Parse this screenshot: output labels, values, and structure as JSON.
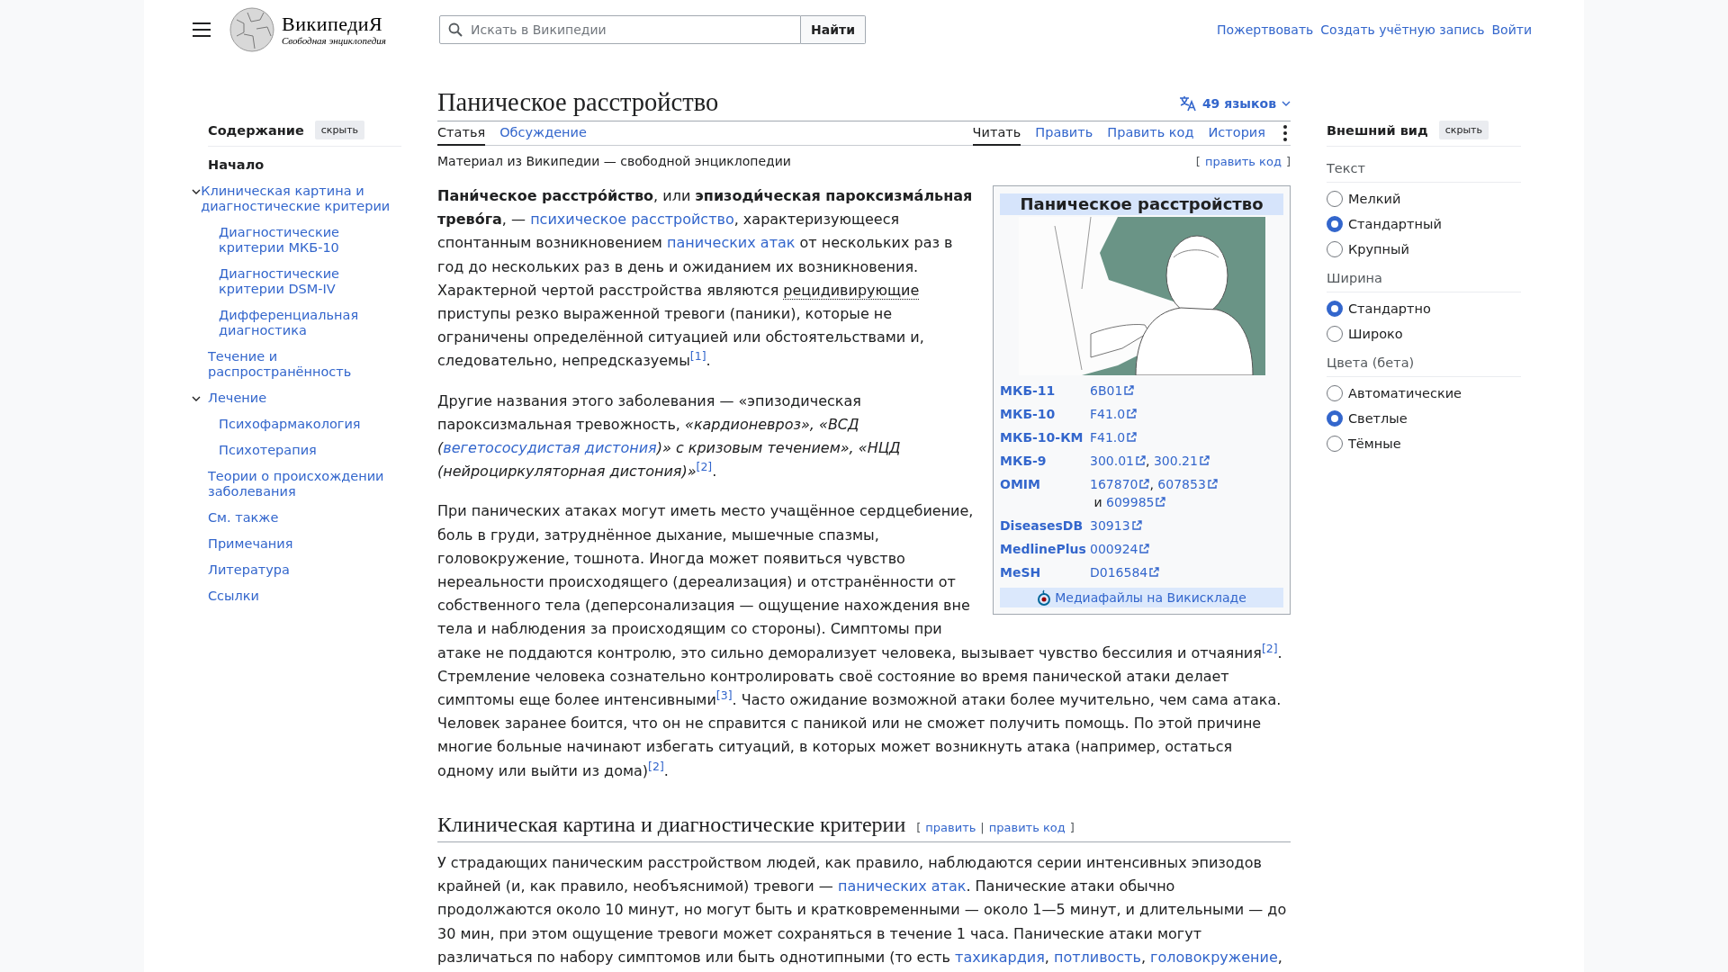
{
  "header": {
    "wordmark": "ВикипедиЯ",
    "tagline": "Свободная энциклопедия",
    "search": {
      "placeholder": "Искать в Википедии",
      "button": "Найти"
    },
    "links": [
      "Пожертвовать",
      "Создать учётную запись",
      "Войти"
    ]
  },
  "toc": {
    "title": "Содержание",
    "hide_button": "скрыть",
    "items": [
      {
        "label": "Начало",
        "selected": true,
        "expanded": false
      },
      {
        "label": "Клиническая картина и диагностические критерии",
        "selected": false,
        "expanded": true,
        "children": [
          {
            "label": "Диагностические критерии МКБ-10",
            "selected": false
          },
          {
            "label": "Диагностические критерии DSM-IV",
            "selected": false
          },
          {
            "label": "Дифференциальная диагностика",
            "selected": false
          }
        ]
      },
      {
        "label": "Течение и распространённость",
        "selected": false,
        "expanded": false
      },
      {
        "label": "Лечение",
        "selected": false,
        "expanded": true,
        "children": [
          {
            "label": "Психофармакология",
            "selected": false
          },
          {
            "label": "Психотерапия",
            "selected": false
          }
        ]
      },
      {
        "label": "Теории о происхождении заболевания",
        "selected": false,
        "expanded": false
      },
      {
        "label": "См. также",
        "selected": false,
        "expanded": false
      },
      {
        "label": "Примечания",
        "selected": false,
        "expanded": false
      },
      {
        "label": "Литература",
        "selected": false,
        "expanded": false
      },
      {
        "label": "Ссылки",
        "selected": false,
        "expanded": false
      }
    ]
  },
  "article": {
    "title": "Паническое расстройство",
    "languages": "49 языков",
    "namespace_tabs": [
      {
        "label": "Статья",
        "selected": true
      },
      {
        "label": "Обсуждение",
        "selected": false
      }
    ],
    "view_tabs": [
      {
        "label": "Читать",
        "selected": true
      },
      {
        "label": "Править",
        "selected": false
      },
      {
        "label": "Править код",
        "selected": false
      },
      {
        "label": "История",
        "selected": false
      }
    ],
    "site_sub": "Материал из Википедии — свободной энциклопедии",
    "top_edit": {
      "open": "[",
      "link": "править код",
      "close": "]"
    },
    "beside_infobox": [
      [
        {
          "kind": "text",
          "text": "**Пани́ческое расстро́йство**, или **эпизоди́ческая пароксизма́льная трево́га**, — "
        },
        {
          "kind": "link",
          "text": "психическое расстройство"
        },
        {
          "kind": "text",
          "text": ", характеризующееся спонтанным возникновением "
        },
        {
          "kind": "link",
          "text": "панических атак"
        },
        {
          "kind": "text",
          "text": " от нескольких раз в год до нескольких раз в день и ожиданием их возникновения. Характерной чертой расстройства являются "
        },
        {
          "kind": "abbr",
          "text": "рецидивирующие"
        },
        {
          "kind": "text",
          "text": " приступы резко выраженной тревоги (паники), которые не ограничены определённой ситуацией или обстоятельствами и, следовательно, непредсказуемы"
        },
        {
          "kind": "ref",
          "text": "[1]"
        },
        {
          "kind": "text",
          "text": "."
        }
      ],
      [
        {
          "kind": "text",
          "text": "Другие названия этого заболевания — «эпизодическая пароксизмальная тревожность, *«кардионевроз», «ВСД (*"
        },
        {
          "kind": "link",
          "text": "вегетососудистая дистония",
          "italic": true
        },
        {
          "kind": "text",
          "text": "*)» с кризовым течением», «НЦД (нейроциркуляторная дистония)»*"
        },
        {
          "kind": "ref",
          "text": "[2]"
        },
        {
          "kind": "text",
          "text": "."
        }
      ],
      [
        {
          "kind": "text",
          "text": "При панических атаках могут иметь место учащённое сердцебиение, боль в груди, затруднённое дыхание, мышечные спазмы, головокружение, тошнота. Иногда может появиться чувство нереальности происходящего (дереализация) и отстранённости от собственного тела (деперсонализация — ощущение нахождения вне тела и наблюдения за происходящим со стороны). Симптомы при"
        }
      ]
    ],
    "below_infobox": [
      [
        {
          "kind": "text",
          "text": "атаке не поддаются контролю, это сильно деморализует человека, вызывает чувство бессилия и отчаяния"
        },
        {
          "kind": "ref",
          "text": "[2]"
        },
        {
          "kind": "text",
          "text": ". Стремление человека сознательно контролировать своё состояние во время панической атаки делает симптомы еще более интенсивными"
        },
        {
          "kind": "ref",
          "text": "[3]"
        },
        {
          "kind": "text",
          "text": ". Часто ожидание возможной атаки более мучительно, чем сама атака. Человек заранее боится, что он не справится с паникой или не сможет получить помощь. По этой причине многие больные начинают избегать ситуаций, в которых может возникнуть атака (например, остаться одному или выйти из дома)"
        },
        {
          "kind": "ref",
          "text": "[2]"
        },
        {
          "kind": "text",
          "text": "."
        }
      ]
    ],
    "sections": [
      {
        "heading": "Клиническая картина и диагностические критерии",
        "edit": {
          "open": "[",
          "links": [
            "править",
            "править код"
          ],
          "separator": "|",
          "close": "]"
        },
        "paragraphs": [
          [
            {
              "kind": "text",
              "text": "У страдающих паническим расстройством людей, как правило, наблюдаются серии интенсивных эпизодов крайней (и, как правило, необъяснимой) тревоги — "
            },
            {
              "kind": "link",
              "text": "панических атак"
            },
            {
              "kind": "text",
              "text": ". Панические атаки обычно продолжаются около 10 минут, но могут быть и кратковременными — около 1—5 минут, и длительными — до 30 мин, при этом ощущение тревоги может сохраняться в течение 1 часа. Панические атаки могут различаться по набору симптомов или быть однотипными (то есть "
            },
            {
              "kind": "link",
              "text": "тахикардия"
            },
            {
              "kind": "text",
              "text": ", "
            },
            {
              "kind": "link",
              "text": "потливость"
            },
            {
              "kind": "text",
              "text": ", "
            },
            {
              "kind": "link",
              "text": "головокружение"
            },
            {
              "kind": "text",
              "text": ","
            }
          ]
        ]
      }
    ]
  },
  "infobox": {
    "title": "Паническое расстройство",
    "rows": [
      {
        "label": "МКБ-11",
        "values": [
          {
            "kind": "external_link",
            "text": "6B01"
          }
        ]
      },
      {
        "label": "МКБ-10",
        "values": [
          {
            "kind": "external_link",
            "text": "F41.0"
          }
        ]
      },
      {
        "label": "МКБ-10-КМ",
        "values": [
          {
            "kind": "external_link",
            "text": "F41.0"
          }
        ]
      },
      {
        "label": "МКБ-9",
        "values": [
          {
            "kind": "external_link",
            "text": "300.01"
          },
          {
            "kind": "text",
            "text": ", "
          },
          {
            "kind": "external_link",
            "text": "300.21"
          }
        ]
      },
      {
        "label": "OMIM",
        "values": [
          {
            "kind": "external_link",
            "text": "167870"
          },
          {
            "kind": "text",
            "text": ", "
          },
          {
            "kind": "external_link",
            "text": "607853"
          },
          {
            "kind": "text",
            "text": " и "
          },
          {
            "kind": "external_link",
            "text": "609985"
          }
        ]
      },
      {
        "label": "DiseasesDB",
        "values": [
          {
            "kind": "external_link",
            "text": "30913"
          }
        ]
      },
      {
        "label": "MedlinePlus",
        "values": [
          {
            "kind": "external_link",
            "text": "000924"
          }
        ]
      },
      {
        "label": "MeSH",
        "values": [
          {
            "kind": "external_link",
            "text": "D016584"
          }
        ]
      }
    ],
    "commons_link": "Медиафайлы на Викискладе"
  },
  "appearance": {
    "title": "Внешний вид",
    "hide_button": "скрыть",
    "groups": [
      {
        "title": "Текст",
        "options": [
          {
            "label": "Мелкий",
            "selected": false
          },
          {
            "label": "Стандартный",
            "selected": true
          },
          {
            "label": "Крупный",
            "selected": false
          }
        ]
      },
      {
        "title": "Ширина",
        "options": [
          {
            "label": "Стандартно",
            "selected": true
          },
          {
            "label": "Широко",
            "selected": false
          }
        ]
      },
      {
        "title": "Цвета (бета)",
        "options": [
          {
            "label": "Автоматические",
            "selected": false
          },
          {
            "label": "Светлые",
            "selected": true
          },
          {
            "label": "Тёмные",
            "selected": false
          }
        ]
      }
    ]
  }
}
